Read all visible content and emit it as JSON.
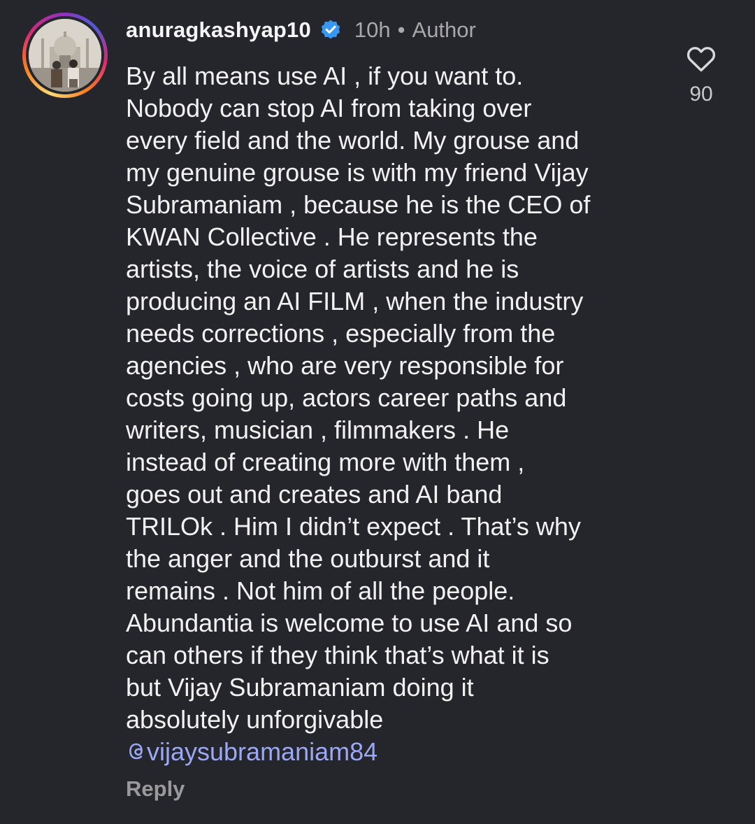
{
  "comment": {
    "username": "anuragkashyap10",
    "verified_icon": "verified-badge-icon",
    "time": "10h",
    "separator": "•",
    "role": "Author",
    "lines": [
      "By all means use AI , if you want to.",
      "Nobody can stop AI from taking over",
      "every field and the world. My grouse and",
      "my genuine grouse is with my friend Vijay",
      "Subramaniam , because he is the CEO of",
      "KWAN Collective . He represents the",
      "artists, the voice of artists and he is",
      "producing an AI FILM , when the industry",
      "needs corrections , especially from the",
      "agencies , who are very responsible for",
      "costs going up, actors career paths and",
      "writers, musician , filmmakers . He",
      "instead of creating more with them ,",
      "goes out and creates and AI band",
      "TRILOk . Him I didn’t expect . That’s why",
      "the anger and the outburst and it",
      "remains . Not him of all the people.",
      "Abundantia is welcome to use AI and so",
      "can others if they think that’s what it is",
      "but Vijay Subramaniam doing it",
      "absolutely unforgivable"
    ],
    "mention": "vijaysubramaniam84",
    "mention_icon": "threads-at-icon",
    "reply_label": "Reply",
    "like_icon": "heart-icon",
    "like_count": "90"
  },
  "colors": {
    "background": "#24262b",
    "text": "#f2f2f2",
    "muted": "#a8a8a8",
    "mention": "#9aa8f5",
    "verified": "#3897f0"
  }
}
